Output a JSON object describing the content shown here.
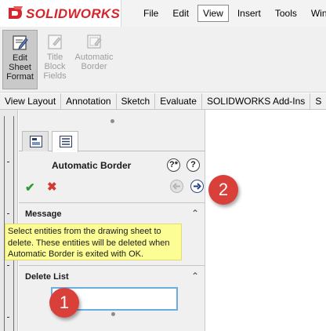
{
  "app": {
    "logo_text": "SOLIDWORKS"
  },
  "menu": [
    {
      "label": "File"
    },
    {
      "label": "Edit"
    },
    {
      "label": "View",
      "active": true
    },
    {
      "label": "Insert"
    },
    {
      "label": "Tools"
    },
    {
      "label": "Windo"
    }
  ],
  "command_manager": {
    "edit_sheet_format": "Edit\nSheet\nFormat",
    "title_block_fields": "Title\nBlock\nFields",
    "automatic_border": "Automatic\nBorder"
  },
  "tabs": [
    {
      "label": "View Layout"
    },
    {
      "label": "Annotation"
    },
    {
      "label": "Sketch"
    },
    {
      "label": "Evaluate"
    },
    {
      "label": "SOLIDWORKS Add-Ins"
    },
    {
      "label": "S"
    }
  ],
  "property_manager": {
    "title": "Automatic Border",
    "help_icons": [
      "?*",
      "?"
    ],
    "sections": {
      "message": {
        "title": "Message",
        "text": "Select entities from the drawing sheet to delete. These entities will be deleted when Automatic Border is exited with OK."
      },
      "delete_list": {
        "title": "Delete List"
      }
    }
  },
  "callouts": [
    "2",
    "1"
  ],
  "colors": {
    "accent_red": "#d6252b",
    "message_bg": "#fdfd96",
    "ok_green": "#2e9a34",
    "cancel_red": "#d23b2e",
    "callout_red": "#d9403a"
  }
}
